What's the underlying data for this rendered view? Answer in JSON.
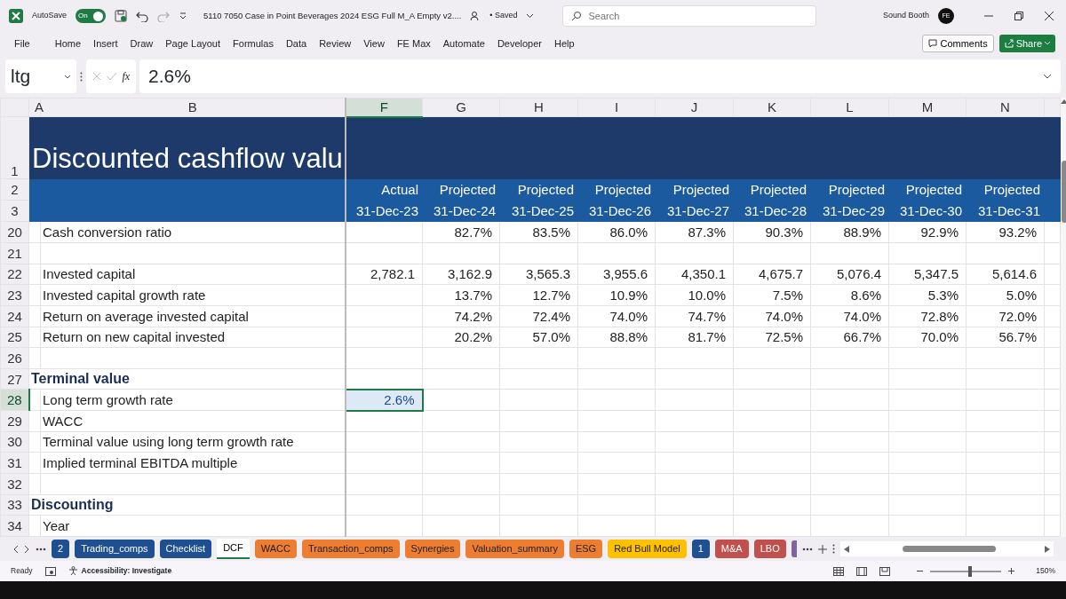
{
  "title_bar": {
    "autosave_label": "AutoSave",
    "autosave_on": true,
    "toggle_label": "On",
    "file_title": "5110 7050 Case in Point Beverages 2024 ESG Full M_A Empty v2....",
    "save_status": "• Saved",
    "search": {
      "placeholder": "Search"
    },
    "user_name": "Sound Booth",
    "avatar_initials": "FE"
  },
  "menu": [
    "File",
    "Home",
    "Insert",
    "Draw",
    "Page Layout",
    "Formulas",
    "Data",
    "Review",
    "View",
    "FE Max",
    "Automate",
    "Developer",
    "Help"
  ],
  "actions": [
    "Comments",
    "Share"
  ],
  "formula_bar": {
    "name_box": "ltg",
    "function_label": "fx",
    "value": "2.6%"
  },
  "columns": [
    {
      "label": "A",
      "selected": false
    },
    {
      "label": "B",
      "selected": false
    },
    {
      "label": "F",
      "selected": true
    },
    {
      "label": "G",
      "selected": false
    },
    {
      "label": "H",
      "selected": false
    },
    {
      "label": "I",
      "selected": false
    },
    {
      "label": "J",
      "selected": false
    },
    {
      "label": "K",
      "selected": false
    },
    {
      "label": "L",
      "selected": false
    },
    {
      "label": "M",
      "selected": false
    },
    {
      "label": "N",
      "selected": false
    }
  ],
  "rows": [
    {
      "num": "1",
      "kind": "title",
      "selected": false,
      "label": "Discounted cashflow valu"
    },
    {
      "num": "2",
      "kind": "header",
      "selected": false,
      "values": [
        "Actual",
        "Projected",
        "Projected",
        "Projected",
        "Projected",
        "Projected",
        "Projected",
        "Projected",
        "Projected"
      ]
    },
    {
      "num": "3",
      "kind": "header",
      "selected": false,
      "values": [
        "31-Dec-23",
        "31-Dec-24",
        "31-Dec-25",
        "31-Dec-26",
        "31-Dec-27",
        "31-Dec-28",
        "31-Dec-29",
        "31-Dec-30",
        "31-Dec-31"
      ]
    },
    {
      "num": "20",
      "kind": "item",
      "selected": false,
      "label": "Cash conversion ratio",
      "values": {
        "G": "82.7%",
        "H": "83.5%",
        "I": "86.0%",
        "J": "87.3%",
        "K": "90.3%",
        "L": "88.9%",
        "M": "92.9%",
        "N": "93.2%"
      }
    },
    {
      "num": "21",
      "kind": "blank",
      "selected": false
    },
    {
      "num": "22",
      "kind": "item",
      "selected": false,
      "label": "Invested capital",
      "values": {
        "F": "2,782.1",
        "G": "3,162.9",
        "H": "3,565.3",
        "I": "3,955.6",
        "J": "4,350.1",
        "K": "4,675.7",
        "L": "5,076.4",
        "M": "5,347.5",
        "N": "5,614.6"
      }
    },
    {
      "num": "23",
      "kind": "item",
      "selected": false,
      "label": "Invested capital growth rate",
      "values": {
        "G": "13.7%",
        "H": "12.7%",
        "I": "10.9%",
        "J": "10.0%",
        "K": "7.5%",
        "L": "8.6%",
        "M": "5.3%",
        "N": "5.0%"
      }
    },
    {
      "num": "24",
      "kind": "item",
      "selected": false,
      "label": "Return on average invested capital",
      "values": {
        "G": "74.2%",
        "H": "72.4%",
        "I": "74.0%",
        "J": "74.7%",
        "K": "74.0%",
        "L": "74.0%",
        "M": "72.8%",
        "N": "72.0%"
      }
    },
    {
      "num": "25",
      "kind": "item",
      "selected": false,
      "label": "Return on new capital invested",
      "values": {
        "G": "20.2%",
        "H": "57.0%",
        "I": "88.8%",
        "J": "81.7%",
        "K": "72.5%",
        "L": "66.7%",
        "M": "70.0%",
        "N": "56.7%"
      }
    },
    {
      "num": "26",
      "kind": "blank",
      "selected": false
    },
    {
      "num": "27",
      "kind": "section",
      "selected": false,
      "label": "Terminal value"
    },
    {
      "num": "28",
      "kind": "item",
      "selected": true,
      "label": "Long term growth rate",
      "values": {
        "F": "2.6%"
      }
    },
    {
      "num": "29",
      "kind": "item",
      "selected": false,
      "label": "WACC"
    },
    {
      "num": "30",
      "kind": "item",
      "selected": false,
      "label": "Terminal value using long term growth rate"
    },
    {
      "num": "31",
      "kind": "item",
      "selected": false,
      "label": "Implied terminal EBITDA multiple"
    },
    {
      "num": "32",
      "kind": "blank",
      "selected": false
    },
    {
      "num": "33",
      "kind": "section",
      "selected": false,
      "label": "Discounting"
    },
    {
      "num": "34",
      "kind": "item",
      "selected": false,
      "label": "Year"
    }
  ],
  "sheet_tabs": [
    {
      "label": "2",
      "color": "#1d4f91",
      "selected": false
    },
    {
      "label": "Trading_comps",
      "color": "#1d4f91",
      "selected": false
    },
    {
      "label": "Checklist",
      "color": "#1d4f91",
      "selected": false
    },
    {
      "label": "DCF",
      "selected": true
    },
    {
      "label": "WACC",
      "color": "#ed7d31",
      "selected": false
    },
    {
      "label": "Transaction_comps",
      "color": "#ed7d31",
      "selected": false
    },
    {
      "label": "Synergies",
      "color": "#ed7d31",
      "selected": false
    },
    {
      "label": "Valuation_summary",
      "color": "#ed7d31",
      "selected": false
    },
    {
      "label": "ESG",
      "color": "#ed7d31",
      "selected": false
    },
    {
      "label": "Red Bull Model",
      "color": "#ffc000",
      "selected": false
    },
    {
      "label": "1",
      "color": "#1d4f91",
      "selected": false
    },
    {
      "label": "M&A",
      "color": "#c0504d",
      "selected": false
    },
    {
      "label": "LBO",
      "color": "#c0504d",
      "selected": false
    },
    {
      "color": "#8064a2",
      "selected": false
    }
  ],
  "status_bar": {
    "status": "Ready",
    "accessibility": "Accessibility: Investigate",
    "zoom": {
      "level": 0.56,
      "reading": "150%"
    }
  }
}
